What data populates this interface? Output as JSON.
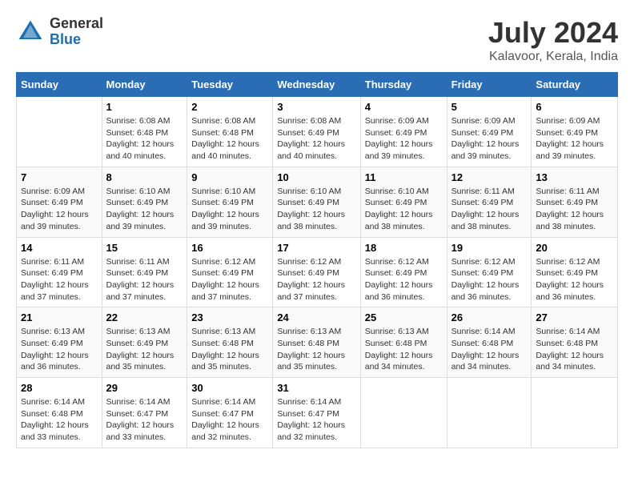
{
  "header": {
    "logo_general": "General",
    "logo_blue": "Blue",
    "title": "July 2024",
    "subtitle": "Kalavoor, Kerala, India"
  },
  "days_of_week": [
    "Sunday",
    "Monday",
    "Tuesday",
    "Wednesday",
    "Thursday",
    "Friday",
    "Saturday"
  ],
  "weeks": [
    [
      {
        "day": "",
        "sunrise": "",
        "sunset": "",
        "daylight": ""
      },
      {
        "day": "1",
        "sunrise": "Sunrise: 6:08 AM",
        "sunset": "Sunset: 6:48 PM",
        "daylight": "Daylight: 12 hours and 40 minutes."
      },
      {
        "day": "2",
        "sunrise": "Sunrise: 6:08 AM",
        "sunset": "Sunset: 6:48 PM",
        "daylight": "Daylight: 12 hours and 40 minutes."
      },
      {
        "day": "3",
        "sunrise": "Sunrise: 6:08 AM",
        "sunset": "Sunset: 6:49 PM",
        "daylight": "Daylight: 12 hours and 40 minutes."
      },
      {
        "day": "4",
        "sunrise": "Sunrise: 6:09 AM",
        "sunset": "Sunset: 6:49 PM",
        "daylight": "Daylight: 12 hours and 39 minutes."
      },
      {
        "day": "5",
        "sunrise": "Sunrise: 6:09 AM",
        "sunset": "Sunset: 6:49 PM",
        "daylight": "Daylight: 12 hours and 39 minutes."
      },
      {
        "day": "6",
        "sunrise": "Sunrise: 6:09 AM",
        "sunset": "Sunset: 6:49 PM",
        "daylight": "Daylight: 12 hours and 39 minutes."
      }
    ],
    [
      {
        "day": "7",
        "sunrise": "Sunrise: 6:09 AM",
        "sunset": "Sunset: 6:49 PM",
        "daylight": "Daylight: 12 hours and 39 minutes."
      },
      {
        "day": "8",
        "sunrise": "Sunrise: 6:10 AM",
        "sunset": "Sunset: 6:49 PM",
        "daylight": "Daylight: 12 hours and 39 minutes."
      },
      {
        "day": "9",
        "sunrise": "Sunrise: 6:10 AM",
        "sunset": "Sunset: 6:49 PM",
        "daylight": "Daylight: 12 hours and 39 minutes."
      },
      {
        "day": "10",
        "sunrise": "Sunrise: 6:10 AM",
        "sunset": "Sunset: 6:49 PM",
        "daylight": "Daylight: 12 hours and 38 minutes."
      },
      {
        "day": "11",
        "sunrise": "Sunrise: 6:10 AM",
        "sunset": "Sunset: 6:49 PM",
        "daylight": "Daylight: 12 hours and 38 minutes."
      },
      {
        "day": "12",
        "sunrise": "Sunrise: 6:11 AM",
        "sunset": "Sunset: 6:49 PM",
        "daylight": "Daylight: 12 hours and 38 minutes."
      },
      {
        "day": "13",
        "sunrise": "Sunrise: 6:11 AM",
        "sunset": "Sunset: 6:49 PM",
        "daylight": "Daylight: 12 hours and 38 minutes."
      }
    ],
    [
      {
        "day": "14",
        "sunrise": "Sunrise: 6:11 AM",
        "sunset": "Sunset: 6:49 PM",
        "daylight": "Daylight: 12 hours and 37 minutes."
      },
      {
        "day": "15",
        "sunrise": "Sunrise: 6:11 AM",
        "sunset": "Sunset: 6:49 PM",
        "daylight": "Daylight: 12 hours and 37 minutes."
      },
      {
        "day": "16",
        "sunrise": "Sunrise: 6:12 AM",
        "sunset": "Sunset: 6:49 PM",
        "daylight": "Daylight: 12 hours and 37 minutes."
      },
      {
        "day": "17",
        "sunrise": "Sunrise: 6:12 AM",
        "sunset": "Sunset: 6:49 PM",
        "daylight": "Daylight: 12 hours and 37 minutes."
      },
      {
        "day": "18",
        "sunrise": "Sunrise: 6:12 AM",
        "sunset": "Sunset: 6:49 PM",
        "daylight": "Daylight: 12 hours and 36 minutes."
      },
      {
        "day": "19",
        "sunrise": "Sunrise: 6:12 AM",
        "sunset": "Sunset: 6:49 PM",
        "daylight": "Daylight: 12 hours and 36 minutes."
      },
      {
        "day": "20",
        "sunrise": "Sunrise: 6:12 AM",
        "sunset": "Sunset: 6:49 PM",
        "daylight": "Daylight: 12 hours and 36 minutes."
      }
    ],
    [
      {
        "day": "21",
        "sunrise": "Sunrise: 6:13 AM",
        "sunset": "Sunset: 6:49 PM",
        "daylight": "Daylight: 12 hours and 36 minutes."
      },
      {
        "day": "22",
        "sunrise": "Sunrise: 6:13 AM",
        "sunset": "Sunset: 6:49 PM",
        "daylight": "Daylight: 12 hours and 35 minutes."
      },
      {
        "day": "23",
        "sunrise": "Sunrise: 6:13 AM",
        "sunset": "Sunset: 6:48 PM",
        "daylight": "Daylight: 12 hours and 35 minutes."
      },
      {
        "day": "24",
        "sunrise": "Sunrise: 6:13 AM",
        "sunset": "Sunset: 6:48 PM",
        "daylight": "Daylight: 12 hours and 35 minutes."
      },
      {
        "day": "25",
        "sunrise": "Sunrise: 6:13 AM",
        "sunset": "Sunset: 6:48 PM",
        "daylight": "Daylight: 12 hours and 34 minutes."
      },
      {
        "day": "26",
        "sunrise": "Sunrise: 6:14 AM",
        "sunset": "Sunset: 6:48 PM",
        "daylight": "Daylight: 12 hours and 34 minutes."
      },
      {
        "day": "27",
        "sunrise": "Sunrise: 6:14 AM",
        "sunset": "Sunset: 6:48 PM",
        "daylight": "Daylight: 12 hours and 34 minutes."
      }
    ],
    [
      {
        "day": "28",
        "sunrise": "Sunrise: 6:14 AM",
        "sunset": "Sunset: 6:48 PM",
        "daylight": "Daylight: 12 hours and 33 minutes."
      },
      {
        "day": "29",
        "sunrise": "Sunrise: 6:14 AM",
        "sunset": "Sunset: 6:47 PM",
        "daylight": "Daylight: 12 hours and 33 minutes."
      },
      {
        "day": "30",
        "sunrise": "Sunrise: 6:14 AM",
        "sunset": "Sunset: 6:47 PM",
        "daylight": "Daylight: 12 hours and 32 minutes."
      },
      {
        "day": "31",
        "sunrise": "Sunrise: 6:14 AM",
        "sunset": "Sunset: 6:47 PM",
        "daylight": "Daylight: 12 hours and 32 minutes."
      },
      {
        "day": "",
        "sunrise": "",
        "sunset": "",
        "daylight": ""
      },
      {
        "day": "",
        "sunrise": "",
        "sunset": "",
        "daylight": ""
      },
      {
        "day": "",
        "sunrise": "",
        "sunset": "",
        "daylight": ""
      }
    ]
  ]
}
